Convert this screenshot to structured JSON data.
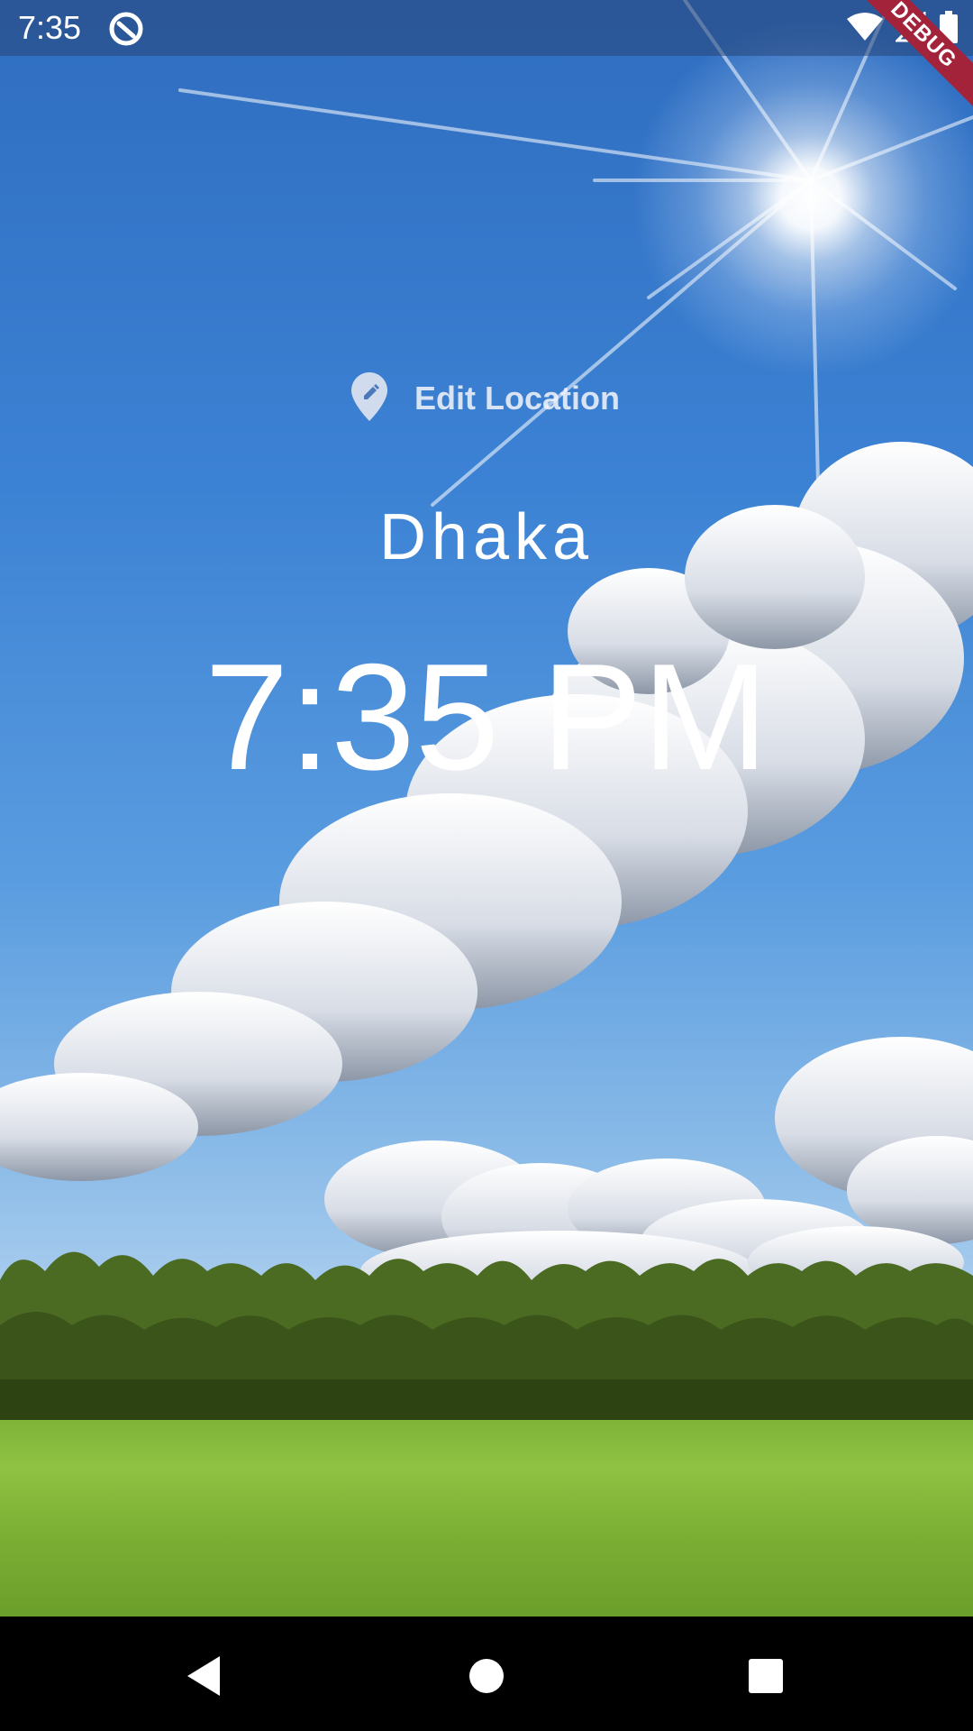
{
  "status_bar": {
    "time": "7:35",
    "app_icon": "circle-arrow-icon",
    "wifi_icon": "wifi-icon",
    "signal_icon": "signal-icon",
    "battery_icon": "battery-icon",
    "debug_banner": "DEBUG"
  },
  "main": {
    "edit_location_icon": "map-pin-edit-icon",
    "edit_location_label": "Edit Location",
    "city": "Dhaka",
    "time": "7:35 PM"
  },
  "nav_bar": {
    "back_icon": "triangle-back-icon",
    "home_icon": "circle-home-icon",
    "recents_icon": "square-recents-icon"
  },
  "colors": {
    "debug_banner": "#a3233b",
    "sky": "#3c82d4",
    "grass": "#8fc242",
    "text": "#ffffff"
  }
}
